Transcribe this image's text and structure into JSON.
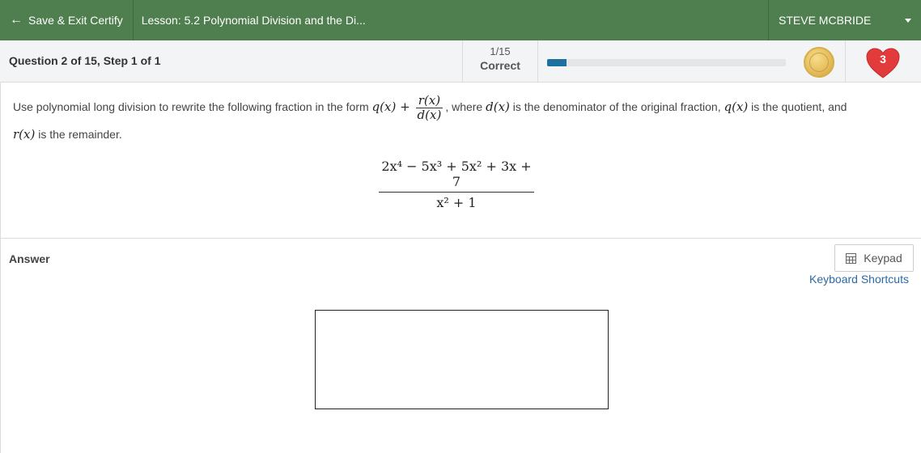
{
  "header": {
    "back_label": "Save & Exit Certify",
    "lesson_title": "Lesson: 5.2 Polynomial Division and the Di...",
    "user_name": "STEVE MCBRIDE"
  },
  "status": {
    "question_title": "Question 2 of 15, Step 1 of 1",
    "score_count": "1/15",
    "score_label": "Correct",
    "progress_fraction": 0.08,
    "hearts": "3"
  },
  "question": {
    "text_1": "Use polynomial long division to rewrite the following fraction in the form",
    "form_q": "q(x) +",
    "form_num": "r(x)",
    "form_den": "d(x)",
    "text_2": ", where",
    "d_of_x": "d(x)",
    "text_3": "is the denominator of the original fraction,",
    "q_of_x": "q(x)",
    "text_4": "is the quotient, and",
    "r_of_x": "r(x)",
    "text_5": "is the remainder.",
    "fraction_numerator": "2x⁴ − 5x³ + 5x² + 3x + 7",
    "fraction_denominator": "x² + 1"
  },
  "answer": {
    "label": "Answer",
    "keypad_label": "Keypad",
    "shortcuts_label": "Keyboard Shortcuts",
    "value": ""
  },
  "colors": {
    "header_green": "#4f7e4f",
    "progress_blue": "#1f6fa3",
    "heart_red": "#e23b3b",
    "link_blue": "#2a6aa6"
  }
}
